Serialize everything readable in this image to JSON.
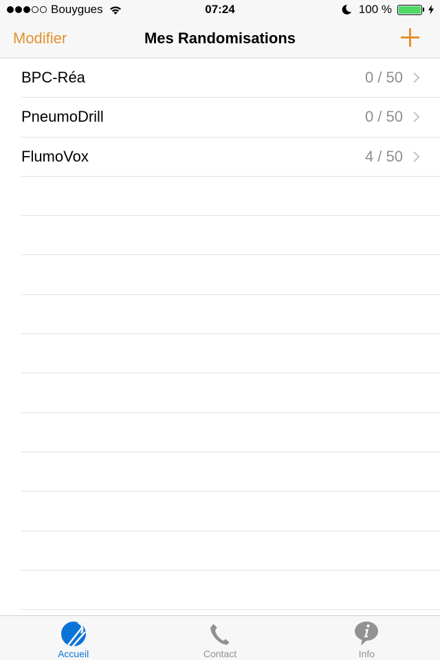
{
  "status_bar": {
    "signal_bars_filled": 3,
    "signal_bars_total": 5,
    "carrier": "Bouygues",
    "time": "07:24",
    "battery_percent_label": "100 %",
    "battery_level": 1.0,
    "icons": [
      "wifi-icon",
      "moon-icon",
      "battery-icon",
      "charging-bolt-icon"
    ]
  },
  "navbar": {
    "left_button": "Modifier",
    "title": "Mes Randomisations",
    "right_button_icon": "plus-icon"
  },
  "colors": {
    "accent": "#e3912f",
    "tab_active": "#0a74d8",
    "tab_inactive": "#929292",
    "detail_text": "#8e8e93",
    "battery": "#4cd964"
  },
  "list": {
    "items": [
      {
        "title": "BPC-Réa",
        "detail": "0 / 50"
      },
      {
        "title": "PneumoDrill",
        "detail": "0 / 50"
      },
      {
        "title": "FlumoVox",
        "detail": "4 / 50"
      }
    ]
  },
  "tabbar": {
    "tabs": [
      {
        "label": "Accueil",
        "icon": "home-globe-icon",
        "active": true
      },
      {
        "label": "Contact",
        "icon": "phone-icon",
        "active": false
      },
      {
        "label": "Info",
        "icon": "info-bubble-icon",
        "active": false
      }
    ]
  }
}
